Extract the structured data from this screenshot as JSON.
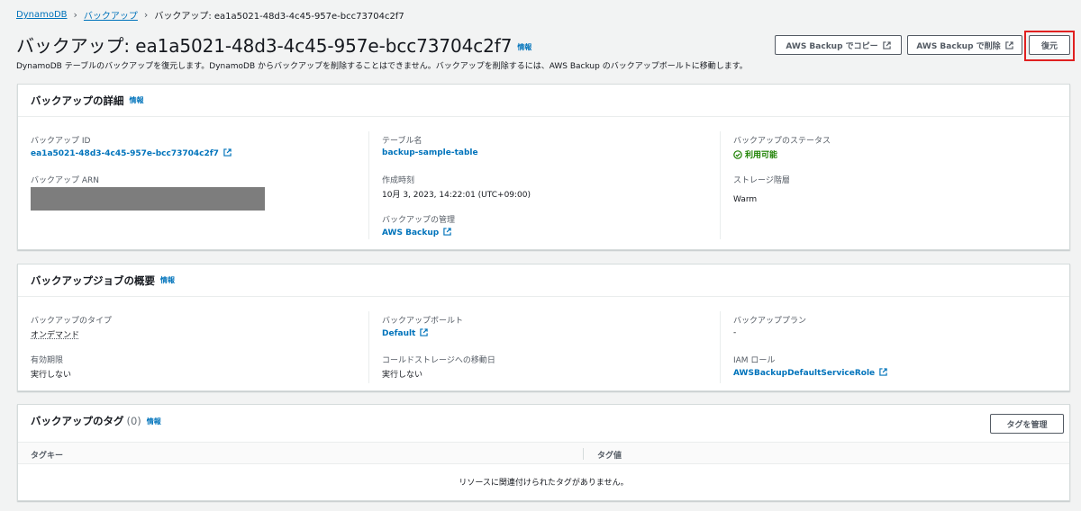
{
  "breadcrumb": {
    "items": [
      "DynamoDB",
      "バックアップ",
      "バックアップ: ea1a5021-48d3-4c45-957e-bcc73704c2f7"
    ]
  },
  "header": {
    "title": "バックアップ: ea1a5021-48d3-4c45-957e-bcc73704c2f7",
    "info": "情報",
    "description": "DynamoDB テーブルのバックアップを復元します。DynamoDB からバックアップを削除することはできません。バックアップを削除するには、AWS Backup のバックアップボールトに移動します。",
    "buttons": {
      "copy": "AWS Backup でコピー",
      "delete": "AWS Backup で削除",
      "restore": "復元"
    }
  },
  "details": {
    "title": "バックアップの詳細",
    "info": "情報",
    "backup_id_label": "バックアップ ID",
    "backup_id": "ea1a5021-48d3-4c45-957e-bcc73704c2f7",
    "arn_label": "バックアップ ARN",
    "table_name_label": "テーブル名",
    "table_name": "backup-sample-table",
    "created_label": "作成時刻",
    "created": "10月 3, 2023, 14:22:01 (UTC+09:00)",
    "management_label": "バックアップの管理",
    "management": "AWS Backup",
    "status_label": "バックアップのステータス",
    "status": "利用可能",
    "storage_label": "ストレージ階層",
    "storage": "Warm"
  },
  "job": {
    "title": "バックアップジョブの概要",
    "info": "情報",
    "type_label": "バックアップのタイプ",
    "type": "オンデマンド",
    "expiry_label": "有効期限",
    "expiry": "実行しない",
    "vault_label": "バックアップボールト",
    "vault": "Default",
    "cold_label": "コールドストレージへの移動日",
    "cold": "実行しない",
    "plan_label": "バックアッププラン",
    "plan": "-",
    "iam_label": "IAM ロール",
    "iam": "AWSBackupDefaultServiceRole"
  },
  "tags": {
    "title": "バックアップのタグ",
    "count": "(0)",
    "info": "情報",
    "manage_button": "タグを管理",
    "col_key": "タグキー",
    "col_value": "タグ値",
    "empty": "リソースに関連付けられたタグがありません。"
  },
  "colors": {
    "link": "#0073bb",
    "success": "#1d8102",
    "highlight": "#e02020"
  }
}
